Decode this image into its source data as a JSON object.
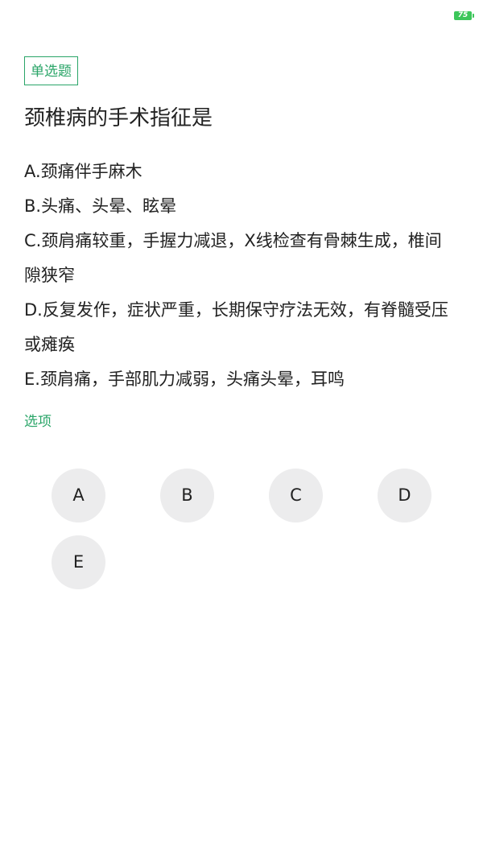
{
  "status_bar": {
    "battery_level": "75",
    "battery_color": "#3cc65a",
    "battery_icon": "battery-icon"
  },
  "question": {
    "type_label": "单选题",
    "title": "颈椎病的手术指征是",
    "options": [
      "A.颈痛伴手麻木",
      "B.头痛、头晕、眩晕",
      "C.颈肩痛较重，手握力减退，X线检查有骨棘生成，椎间隙狭窄",
      "D.反复发作，症状严重，长期保守疗法无效，有脊髓受压或瘫痪",
      "E.颈肩痛，手部肌力减弱，头痛头晕，耳鸣"
    ]
  },
  "answers": {
    "section_label": "选项",
    "choices": [
      "A",
      "B",
      "C",
      "D",
      "E"
    ]
  },
  "colors": {
    "accent": "#2aa568",
    "choice_background": "#ececed",
    "text": "#222222"
  }
}
